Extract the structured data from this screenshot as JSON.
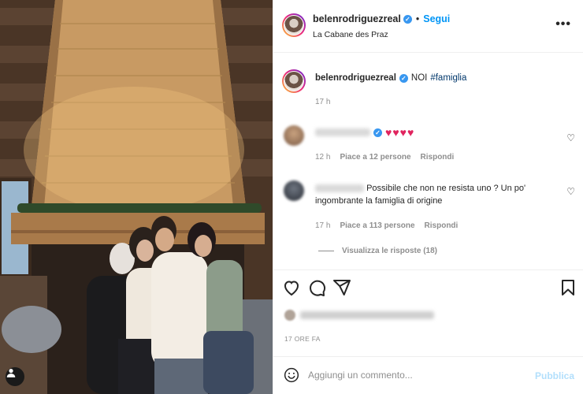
{
  "post": {
    "username": "belenrodriguezreal",
    "follow_label": "Segui",
    "dot": "•",
    "location": "La Cabane des Praz",
    "more_label": "•••"
  },
  "caption": {
    "username": "belenrodriguezreal",
    "text": "NOI",
    "hashtag": "#famiglia",
    "time": "17 h"
  },
  "comments": [
    {
      "text": "♥♥♥♥",
      "time": "12 h",
      "likes": "Piace a 12 persone",
      "reply": "Rispondi"
    },
    {
      "text": "Possibile che non ne resista uno ? Un po' ingombrante la famiglia di origine",
      "time": "17 h",
      "likes": "Piace a 113 persone",
      "reply": "Rispondi"
    }
  ],
  "view_replies": "Visualizza le risposte (18)",
  "posted_ago": "17 ORE FA",
  "add_comment": {
    "placeholder": "Aggiungi un commento...",
    "publish_label": "Pubblica"
  },
  "icons": {
    "like": "heart-icon",
    "comment": "comment-icon",
    "share": "paper-plane-icon",
    "save": "bookmark-icon",
    "emoji": "smiley-icon",
    "more": "more-options-icon",
    "verified": "verified-badge-icon",
    "user_tag": "user-tag-icon"
  },
  "colors": {
    "link_blue": "#0095f6",
    "verified_blue": "#3897f0",
    "hashtag": "#00376b",
    "muted": "#8e8e8e",
    "publish_disabled": "#b2dffc"
  }
}
